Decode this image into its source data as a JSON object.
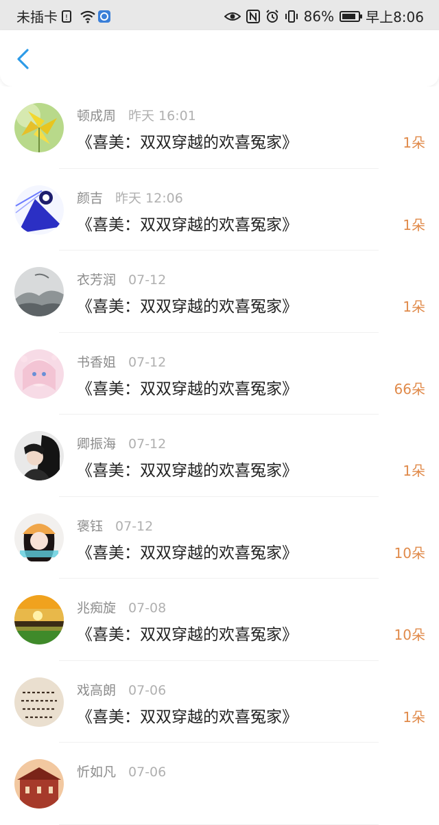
{
  "status_bar": {
    "carrier": "未插卡",
    "battery_percent": "86%",
    "battery_level": 0.86,
    "time": "早上8:06",
    "icons": [
      "sim-icon",
      "wifi-icon",
      "app-icon",
      "eye-icon",
      "nfc-icon",
      "alarm-icon",
      "vibrate-icon",
      "battery-icon"
    ]
  },
  "nav": {
    "back_icon": "chevron-left-icon",
    "accent_color": "#2d9be8"
  },
  "colors": {
    "amount": "#e08a4a",
    "name": "#8c8c8c",
    "time": "#b0b0b0",
    "title": "#222222"
  },
  "list": {
    "items": [
      {
        "name": "顿成周",
        "time": "昨天 16:01",
        "title": "《喜美：双双穿越的欢喜冤家》",
        "amount": "1朵",
        "avatar": "pinwheel-avatar"
      },
      {
        "name": "颜吉",
        "time": "昨天 12:06",
        "title": "《喜美：双双穿越的欢喜冤家》",
        "amount": "1朵",
        "avatar": "anime-blue-avatar"
      },
      {
        "name": "衣芳润",
        "time": "07-12",
        "title": "《喜美：双双穿越的欢喜冤家》",
        "amount": "1朵",
        "avatar": "ink-landscape-avatar"
      },
      {
        "name": "书香姐",
        "time": "07-12",
        "title": "《喜美：双双穿越的欢喜冤家》",
        "amount": "66朵",
        "avatar": "anime-girl-avatar"
      },
      {
        "name": "卿振海",
        "time": "07-12",
        "title": "《喜美：双双穿越的欢喜冤家》",
        "amount": "1朵",
        "avatar": "couple-photo-avatar"
      },
      {
        "name": "褒钰",
        "time": "07-12",
        "title": "《喜美：双双穿越的欢喜冤家》",
        "amount": "10朵",
        "avatar": "girl-hat-avatar"
      },
      {
        "name": "兆痴旋",
        "time": "07-08",
        "title": "《喜美：双双穿越的欢喜冤家》",
        "amount": "10朵",
        "avatar": "sunset-avatar"
      },
      {
        "name": "戏高朗",
        "time": "07-06",
        "title": "《喜美：双双穿越的欢喜冤家》",
        "amount": "1朵",
        "avatar": "calligraphy-avatar"
      },
      {
        "name": "忻如凡",
        "time": "07-06",
        "title": "",
        "amount": "",
        "avatar": "building-avatar"
      }
    ]
  }
}
